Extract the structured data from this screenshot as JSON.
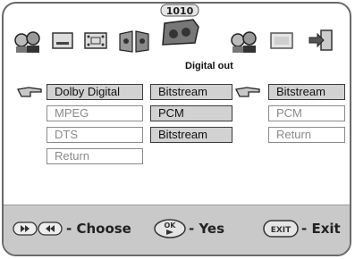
{
  "header": {
    "badge": "1010",
    "section_label": "Digital out"
  },
  "col1": {
    "items": [
      "Dolby Digital",
      "MPEG",
      "DTS",
      "Return"
    ]
  },
  "col2": {
    "items": [
      "Bitstream",
      "PCM",
      "Bitstream"
    ]
  },
  "col3": {
    "items": [
      "Bitstream",
      "PCM",
      "Return"
    ]
  },
  "footer": {
    "choose_label": "- Choose",
    "yes_label": "- Yes",
    "exit_label": "- Exit",
    "ok_text": "OK",
    "exit_text": "EXIT"
  }
}
